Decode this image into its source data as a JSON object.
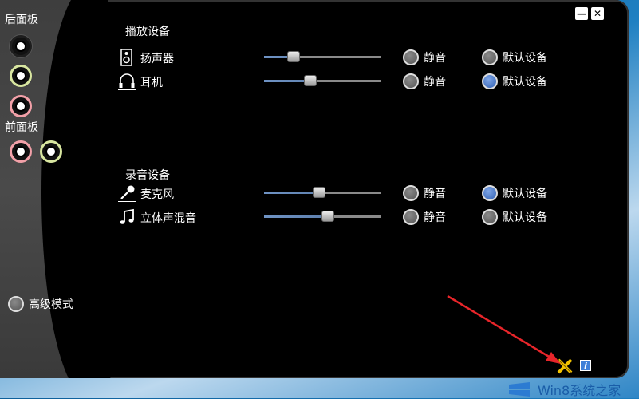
{
  "left_panel": {
    "rear_label": "后面板",
    "front_label": "前面板",
    "advanced_mode_label": "高级模式"
  },
  "playback": {
    "title": "播放设备",
    "devices": [
      {
        "name": "扬声器",
        "icon": "speaker-icon",
        "volume": 0.25,
        "mute_label": "静音",
        "default_label": "默认设备",
        "is_default": false
      },
      {
        "name": "耳机",
        "icon": "headphones-icon",
        "volume": 0.4,
        "mute_label": "静音",
        "default_label": "默认设备",
        "is_default": true
      }
    ]
  },
  "recording": {
    "title": "录音设备",
    "devices": [
      {
        "name": "麦克风",
        "icon": "microphone-icon",
        "volume": 0.47,
        "mute_label": "静音",
        "default_label": "默认设备",
        "is_default": true
      },
      {
        "name": "立体声混音",
        "icon": "music-note-icon",
        "volume": 0.55,
        "mute_label": "静音",
        "default_label": "默认设备",
        "is_default": false
      }
    ]
  },
  "window_controls": {
    "minimize": "—",
    "close": "✕"
  },
  "footer": {
    "info_label": "i"
  },
  "watermark": {
    "text": "Win8系统之家"
  },
  "colors": {
    "accent_blue": "#2f5fb4",
    "slider_fill": "#6f93c4",
    "annotation_arrow": "#e8252a"
  }
}
